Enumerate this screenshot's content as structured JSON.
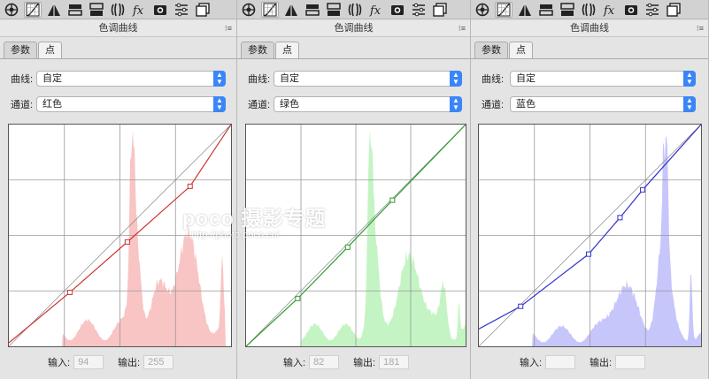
{
  "panels": [
    {
      "title": "色调曲线",
      "tabs": [
        "参数",
        "点"
      ],
      "curve_label": "曲线:",
      "curve_value": "自定",
      "channel_label": "通道:",
      "channel_value": "红色",
      "input_label": "输入:",
      "input_value": "94",
      "output_label": "输出:",
      "output_value": "255",
      "color": "#cc3333",
      "hist_color": "#f8c4c4"
    },
    {
      "title": "色调曲线",
      "tabs": [
        "参数",
        "点"
      ],
      "curve_label": "曲线:",
      "curve_value": "自定",
      "channel_label": "通道:",
      "channel_value": "绿色",
      "input_label": "输入:",
      "input_value": "82",
      "output_label": "输出:",
      "output_value": "181",
      "color": "#2e9a2e",
      "hist_color": "#c4f4c4"
    },
    {
      "title": "色调曲线",
      "tabs": [
        "参数",
        "点"
      ],
      "curve_label": "曲线:",
      "curve_value": "自定",
      "channel_label": "通道:",
      "channel_value": "蓝色",
      "input_label": "输入:",
      "input_value": "",
      "output_label": "输出:",
      "output_value": "",
      "color": "#3333cc",
      "hist_color": "#c6c6fb"
    }
  ],
  "toolbar_icons": [
    "aperture-icon",
    "tone-curve-icon",
    "triangle-icon",
    "split-icon",
    "hsl-icon",
    "lens-icon",
    "fx-icon",
    "camera-icon",
    "presets-icon",
    "snapshots-icon"
  ],
  "watermark": {
    "brand": "poco 摄影专题",
    "url": "http://photo.poco.cn/"
  }
}
